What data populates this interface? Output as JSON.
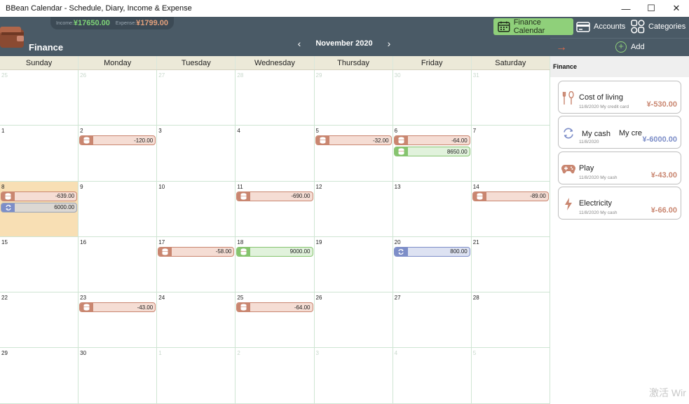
{
  "window": {
    "title": "BBean Calendar - Schedule, Diary, Income & Expense",
    "minimize": "—",
    "maximize": "☐",
    "close": "✕"
  },
  "header": {
    "section": "Finance",
    "income_label": "Income:",
    "income_value": "¥17650.00",
    "expense_label": "Expense:",
    "expense_value": "¥1799.00",
    "month": "November 2020",
    "prev": "‹",
    "next": "›",
    "buttons": {
      "finance_calendar": "Finance Calendar",
      "accounts": "Accounts",
      "categories": "Categories",
      "add": "Add"
    }
  },
  "colors": {
    "header_bg": "#4a5a66",
    "active_button": "#8fd07a",
    "expense": "#c98670",
    "income": "#86c46f",
    "transfer": "#7d8ec8",
    "today": "#f8dfb4"
  },
  "calendar": {
    "weekdays": [
      "Sunday",
      "Monday",
      "Tuesday",
      "Wednesday",
      "Thursday",
      "Friday",
      "Saturday"
    ],
    "weeks": [
      [
        {
          "day": "25",
          "dim": true,
          "entries": []
        },
        {
          "day": "26",
          "dim": true,
          "entries": []
        },
        {
          "day": "27",
          "dim": true,
          "entries": []
        },
        {
          "day": "28",
          "dim": true,
          "entries": []
        },
        {
          "day": "29",
          "dim": true,
          "entries": []
        },
        {
          "day": "30",
          "dim": true,
          "entries": []
        },
        {
          "day": "31",
          "dim": true,
          "entries": []
        }
      ],
      [
        {
          "day": "1",
          "entries": []
        },
        {
          "day": "2",
          "entries": [
            {
              "kind": "red",
              "icon": "coin-icon",
              "amount": "-120.00"
            }
          ]
        },
        {
          "day": "3",
          "entries": []
        },
        {
          "day": "4",
          "entries": []
        },
        {
          "day": "5",
          "entries": [
            {
              "kind": "red",
              "icon": "coin-icon",
              "amount": "-32.00"
            }
          ]
        },
        {
          "day": "6",
          "entries": [
            {
              "kind": "red",
              "icon": "coin-icon",
              "amount": "-64.00"
            },
            {
              "kind": "green",
              "icon": "coin-icon",
              "amount": "8650.00"
            }
          ]
        },
        {
          "day": "7",
          "entries": []
        }
      ],
      [
        {
          "day": "8",
          "today": true,
          "entries": [
            {
              "kind": "red",
              "icon": "coin-icon",
              "amount": "-639.00"
            },
            {
              "kind": "grey",
              "icon": "transfer-icon",
              "amount": "6000.00"
            }
          ]
        },
        {
          "day": "9",
          "entries": []
        },
        {
          "day": "10",
          "entries": []
        },
        {
          "day": "11",
          "entries": [
            {
              "kind": "red",
              "icon": "coin-icon",
              "amount": "-690.00"
            }
          ]
        },
        {
          "day": "12",
          "entries": []
        },
        {
          "day": "13",
          "entries": []
        },
        {
          "day": "14",
          "entries": [
            {
              "kind": "red",
              "icon": "coin-icon",
              "amount": "-89.00"
            }
          ]
        }
      ],
      [
        {
          "day": "15",
          "entries": []
        },
        {
          "day": "16",
          "entries": []
        },
        {
          "day": "17",
          "entries": [
            {
              "kind": "red",
              "icon": "coin-icon",
              "amount": "-58.00"
            }
          ]
        },
        {
          "day": "18",
          "entries": [
            {
              "kind": "green",
              "icon": "coin-icon",
              "amount": "9000.00"
            }
          ]
        },
        {
          "day": "19",
          "entries": []
        },
        {
          "day": "20",
          "entries": [
            {
              "kind": "blue",
              "icon": "transfer-icon",
              "amount": "800.00"
            }
          ]
        },
        {
          "day": "21",
          "entries": []
        }
      ],
      [
        {
          "day": "22",
          "entries": []
        },
        {
          "day": "23",
          "entries": [
            {
              "kind": "red",
              "icon": "coin-icon",
              "amount": "-43.00"
            }
          ]
        },
        {
          "day": "24",
          "entries": []
        },
        {
          "day": "25",
          "entries": [
            {
              "kind": "red",
              "icon": "coin-icon",
              "amount": "-64.00"
            }
          ]
        },
        {
          "day": "26",
          "entries": []
        },
        {
          "day": "27",
          "entries": []
        },
        {
          "day": "28",
          "entries": []
        }
      ],
      [
        {
          "day": "29",
          "entries": []
        },
        {
          "day": "30",
          "entries": []
        },
        {
          "day": "1",
          "dim": true,
          "entries": []
        },
        {
          "day": "2",
          "dim": true,
          "entries": []
        },
        {
          "day": "3",
          "dim": true,
          "entries": []
        },
        {
          "day": "4",
          "dim": true,
          "entries": []
        },
        {
          "day": "5",
          "dim": true,
          "entries": []
        }
      ]
    ]
  },
  "panel": {
    "heading": "Finance",
    "items": [
      {
        "name": "Cost of living",
        "date": "11/8/2020",
        "account": "My credit card",
        "amount": "¥-530.00",
        "icon": "fork-spoon-icon",
        "color": "#c98670"
      },
      {
        "name": "My cash",
        "name2": "My cre",
        "date": "11/8/2020",
        "account": "",
        "amount": "¥-6000.00",
        "icon": "transfer-icon",
        "color": "#7d8ec8"
      },
      {
        "name": "Play",
        "date": "11/8/2020",
        "account": "My cash",
        "amount": "¥-43.00",
        "icon": "gamepad-icon",
        "color": "#c98670"
      },
      {
        "name": "Electricity",
        "date": "11/8/2020",
        "account": "My cash",
        "amount": "¥-66.00",
        "icon": "lightning-icon",
        "color": "#c98670"
      }
    ]
  },
  "watermark": "激活 Wir"
}
